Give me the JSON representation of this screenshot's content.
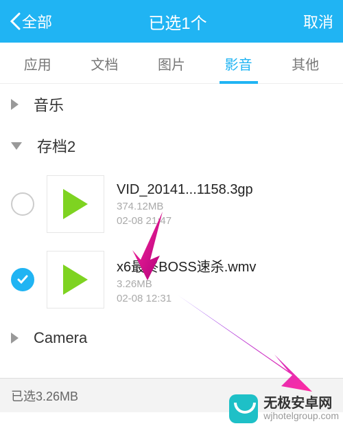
{
  "header": {
    "back_label": "全部",
    "title": "已选1个",
    "cancel_label": "取消"
  },
  "tabs": [
    {
      "label": "应用",
      "active": false
    },
    {
      "label": "文档",
      "active": false
    },
    {
      "label": "图片",
      "active": false
    },
    {
      "label": "影音",
      "active": true
    },
    {
      "label": "其他",
      "active": false
    }
  ],
  "sections": {
    "music": {
      "label": "音乐",
      "expanded": false
    },
    "archive2": {
      "label": "存档2",
      "expanded": true
    },
    "camera": {
      "label": "Camera",
      "expanded": false
    }
  },
  "files": [
    {
      "name": "VID_20141...1158.3gp",
      "size": "374.12MB",
      "date": "02-08 21:47",
      "checked": false
    },
    {
      "name": "x6最终BOSS速杀.wmv",
      "size": "3.26MB",
      "date": "02-08 12:31",
      "checked": true
    }
  ],
  "bottom": {
    "selected_text": "已选3.26MB"
  },
  "watermark": {
    "title": "无极安卓网",
    "subtitle": "wjhotelgroup.com"
  },
  "colors": {
    "accent": "#20b4f3",
    "arrow": "#e6007e"
  }
}
